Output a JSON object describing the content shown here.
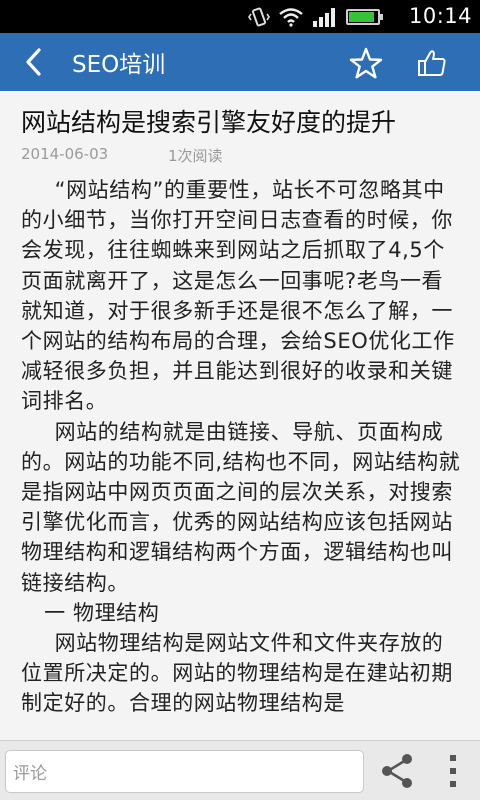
{
  "status_bar": {
    "time": "10:14",
    "battery_level": 0.9,
    "icons": [
      "vibrate-icon",
      "wifi-icon",
      "signal-icon",
      "battery-icon"
    ]
  },
  "app_bar": {
    "title": "SEO培训",
    "icons": [
      "back-arrow-icon",
      "star-icon",
      "thumbs-up-icon"
    ]
  },
  "article": {
    "title": "网站结构是搜索引擎友好度的提升",
    "date": "2014-06-03",
    "reads": "1次阅读",
    "paragraphs": [
      "“网站结构”的重要性，站长不可忽略其中的小细节，当你打开空间日志查看的时候，你会发现，往往蜘蛛来到网站之后抓取了4,5个页面就离开了，这是怎么一回事呢?老鸟一看就知道，对于很多新手还是很不怎么了解，一个网站的结构布局的合理，会给SEO优化工作减轻很多负担，并且能达到很好的收录和关键词排名。",
      "网站的结构就是由链接、导航、页面构成的。网站的功能不同,结构也不同，网站结构就是指网站中网页页面之间的层次关系，对搜索引擎优化而言，优秀的网站结构应该包括网站物理结构和逻辑结构两个方面，逻辑结构也叫链接结构。",
      "一 物理结构",
      "网站物理结构是网站文件和文件夹存放的位置所决定的。网站的物理结构是在建站初期制定好的。合理的网站物理结构是"
    ]
  },
  "bottom_bar": {
    "comment_placeholder": "评论",
    "icons": [
      "share-icon",
      "overflow-menu-icon"
    ]
  },
  "colors": {
    "app_bar": "#2e6eb4",
    "status_bar": "#000000",
    "background": "#f4f4f4",
    "meta_text": "#9a9a9a",
    "body_text": "#222222"
  }
}
